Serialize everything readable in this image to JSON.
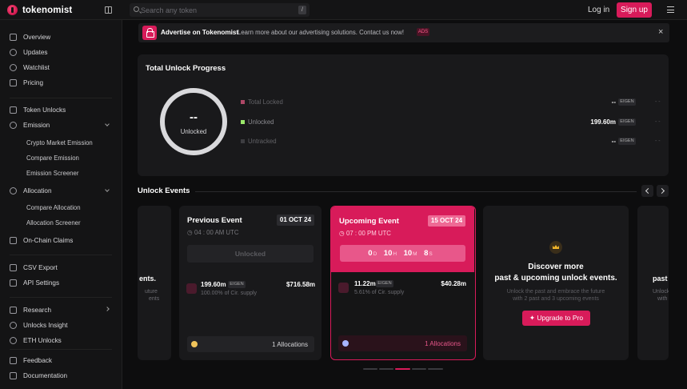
{
  "header": {
    "brand": "tokenomist",
    "search_placeholder": "Search any token",
    "search_shortcut": "/",
    "login_label": "Log in",
    "signup_label": "Sign up"
  },
  "sidebar": {
    "items": [
      {
        "label": "Overview",
        "icon": "grid-icon"
      },
      {
        "label": "Updates",
        "icon": "pulse-icon"
      },
      {
        "label": "Watchlist",
        "icon": "star-icon"
      },
      {
        "label": "Pricing",
        "icon": "tag-icon"
      },
      {
        "label": "Token Unlocks",
        "icon": "lock-icon"
      },
      {
        "label": "Emission",
        "icon": "emission-icon"
      },
      {
        "label": "Crypto Market Emission"
      },
      {
        "label": "Compare Emission"
      },
      {
        "label": "Emission Screener"
      },
      {
        "label": "Allocation",
        "icon": "pie-icon"
      },
      {
        "label": "Compare Allocation"
      },
      {
        "label": "Allocation Screener"
      },
      {
        "label": "On-Chain Claims",
        "icon": "chain-icon"
      },
      {
        "label": "CSV Export",
        "icon": "file-icon"
      },
      {
        "label": "API Settings",
        "icon": "api-icon"
      },
      {
        "label": "Research",
        "icon": "book-icon"
      },
      {
        "label": "Unlocks Insight",
        "icon": "insight-icon"
      },
      {
        "label": "ETH Unlocks",
        "icon": "eth-icon"
      },
      {
        "label": "Feedback",
        "icon": "feedback-icon"
      },
      {
        "label": "Documentation",
        "icon": "doc-icon"
      }
    ]
  },
  "ad": {
    "title": "Advertise on Tokenomist",
    "text": "Learn more about our advertising solutions. Contact us now!",
    "badge": "ADS",
    "close": "×"
  },
  "progress": {
    "title": "Total Unlock Progress",
    "donut_value": "--",
    "donut_label": "Unlocked",
    "rows": [
      {
        "label": "Total Locked",
        "value": "--",
        "unit": "EIGEN",
        "extra": "- -",
        "color": "#e0577f"
      },
      {
        "label": "Unlocked",
        "value": "199.60m",
        "unit": "EIGEN",
        "extra": "- -",
        "color": "#9be86a"
      },
      {
        "label": "Untracked",
        "value": "--",
        "unit": "EIGEN",
        "extra": "- -",
        "color": "#4a4a4e"
      }
    ]
  },
  "events": {
    "title": "Unlock Events",
    "left_fragment": {
      "title": "ents.",
      "sub1": "uture",
      "sub2": "ents"
    },
    "right_fragment": {
      "title": "past",
      "sub1": "Unlock",
      "sub2": "with"
    },
    "previous": {
      "title": "Previous Event",
      "date": "01 OCT 24",
      "time": "04 : 00 AM UTC",
      "status": "Unlocked",
      "amount": "199.60m",
      "unit": "EIGEN",
      "pct": "100.00% of Cir. supply",
      "usd": "$716.58m",
      "allocations": "1 Allocations"
    },
    "upcoming": {
      "title": "Upcoming Event",
      "date": "15 OCT 24",
      "time": "07 : 00 PM UTC",
      "countdown": {
        "d": "0",
        "h": "10",
        "m": "10",
        "s": "8"
      },
      "units": {
        "d": "D",
        "h": "H",
        "m": "M",
        "s": "S"
      },
      "amount": "11.22m",
      "unit": "EIGEN",
      "pct": "5.61% of Cir. supply",
      "usd": "$40.28m",
      "allocations": "1 Allocations"
    },
    "pro": {
      "line1": "Discover more",
      "line2": "past & upcoming unlock events.",
      "sub1": "Unlock the past and embrace the future",
      "sub2": "with 2 past and 3 upcoming events",
      "button": "Upgrade to Pro"
    }
  },
  "colors": {
    "accent": "#d81b5a",
    "background": "#0d0d0e",
    "card": "#19191b"
  }
}
